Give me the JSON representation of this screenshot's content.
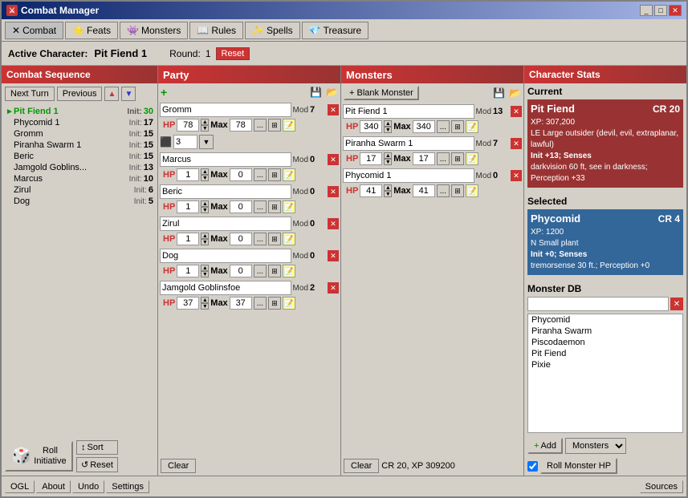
{
  "window": {
    "title": "Combat Manager",
    "active_character": "Pit Fiend 1",
    "round": "1"
  },
  "menu_tabs": [
    {
      "label": "Combat",
      "icon": "✕",
      "active": true
    },
    {
      "label": "Feats",
      "icon": "⭐"
    },
    {
      "label": "Monsters",
      "icon": "👾"
    },
    {
      "label": "Rules",
      "icon": "📖"
    },
    {
      "label": "Spells",
      "icon": "✨"
    },
    {
      "label": "Treasure",
      "icon": "💎"
    }
  ],
  "combat_sequence": {
    "title": "Combat Sequence",
    "next_turn": "Next Turn",
    "previous": "Previous",
    "characters": [
      {
        "name": "Pit Fiend 1",
        "init_label": "Init:",
        "init": 30,
        "active": true
      },
      {
        "name": "Phycomid 1",
        "init_label": "Init:",
        "init": 17,
        "active": false
      },
      {
        "name": "Gromm",
        "init_label": "Init:",
        "init": 15,
        "active": false
      },
      {
        "name": "Piranha Swarm 1",
        "init_label": "Init:",
        "init": 15,
        "active": false
      },
      {
        "name": "Beric",
        "init_label": "Init:",
        "init": 15,
        "active": false
      },
      {
        "name": "Jamgold Goblins...",
        "init_label": "Init:",
        "init": 13,
        "active": false
      },
      {
        "name": "Marcus",
        "init_label": "Init:",
        "init": 10,
        "active": false
      },
      {
        "name": "Zirul",
        "init_label": "Init:",
        "init": 6,
        "active": false
      },
      {
        "name": "Dog",
        "init_label": "Init:",
        "init": 5,
        "active": false
      }
    ],
    "roll_initiative": "Roll\nInitiative",
    "sort": "Sort",
    "reset": "Reset"
  },
  "party": {
    "title": "Party",
    "members": [
      {
        "name": "Gromm",
        "mod_label": "Mod",
        "mod": 7,
        "hp": 78,
        "max_hp": 78,
        "has_special": false
      },
      {
        "name": "Marcus",
        "mod_label": "Mod",
        "mod": 0,
        "hp": 1,
        "max_hp": 0,
        "has_special": false
      },
      {
        "name": "Beric",
        "mod_label": "Mod",
        "mod": 0,
        "hp": 1,
        "max_hp": 0,
        "has_special": false
      },
      {
        "name": "Zirul",
        "mod_label": "Mod",
        "mod": 0,
        "hp": 1,
        "max_hp": 0,
        "has_special": false
      },
      {
        "name": "Dog",
        "mod_label": "Mod",
        "mod": 0,
        "hp": 1,
        "max_hp": 0,
        "has_special": false
      },
      {
        "name": "Jamgold Goblinsfoe",
        "mod_label": "Mod",
        "mod": 2,
        "hp": 37,
        "max_hp": 37,
        "has_special": false
      }
    ],
    "special_member_initiative": "3",
    "clear": "Clear"
  },
  "monsters": {
    "title": "Monsters",
    "blank_monster": "+ Blank Monster",
    "members": [
      {
        "name": "Pit Fiend 1",
        "mod_label": "Mod",
        "mod": 13,
        "hp": 340,
        "max_hp": 340
      },
      {
        "name": "Piranha Swarm 1",
        "mod_label": "Mod",
        "mod": 7,
        "hp": 17,
        "max_hp": 17
      },
      {
        "name": "Phycomid 1",
        "mod_label": "Mod",
        "mod": 0,
        "hp": 41,
        "max_hp": 41
      }
    ],
    "clear": "Clear",
    "status": "CR 20, XP 309200"
  },
  "char_stats": {
    "title": "Character Stats",
    "current_label": "Current",
    "current_monster": {
      "name": "Pit Fiend",
      "cr": "CR 20",
      "xp": "XP: 307,200",
      "type": "LE Large outsider (devil, evil, extraplanar, lawful)",
      "init": "Init +13; Senses",
      "senses": "darkvision 60 ft, see in darkness; Perception +33"
    },
    "selected_label": "Selected",
    "selected_monster": {
      "name": "Phycomid",
      "cr": "CR 4",
      "xp": "XP: 1200",
      "type": "N Small plant",
      "init": "Init +0; Senses",
      "senses": "tremorsense 30 ft.; Perception +0"
    },
    "monster_db_label": "Monster DB",
    "monster_db_items": [
      "Phycomid",
      "Piranha Swarm",
      "Piscodaemon",
      "Pit Fiend",
      "Pixie"
    ],
    "add_label": "Add",
    "monsters_dropdown": "Monsters",
    "roll_monster": "Roll Monster HP",
    "roll_monster_hp_label": "Roll Monster HP"
  },
  "bottom_bar": {
    "ogl": "OGL",
    "about": "About",
    "undo": "Undo",
    "settings": "Settings",
    "sources": "Sources"
  },
  "labels": {
    "active_character": "Active Character:",
    "round": "Round:",
    "reset": "Reset",
    "hp": "HP",
    "max": "Max",
    "mod": "Mod",
    "next_turn": "Next Turn",
    "previous": "Previous",
    "sort": "Sort",
    "clear": "Clear",
    "add": "+ Add"
  }
}
